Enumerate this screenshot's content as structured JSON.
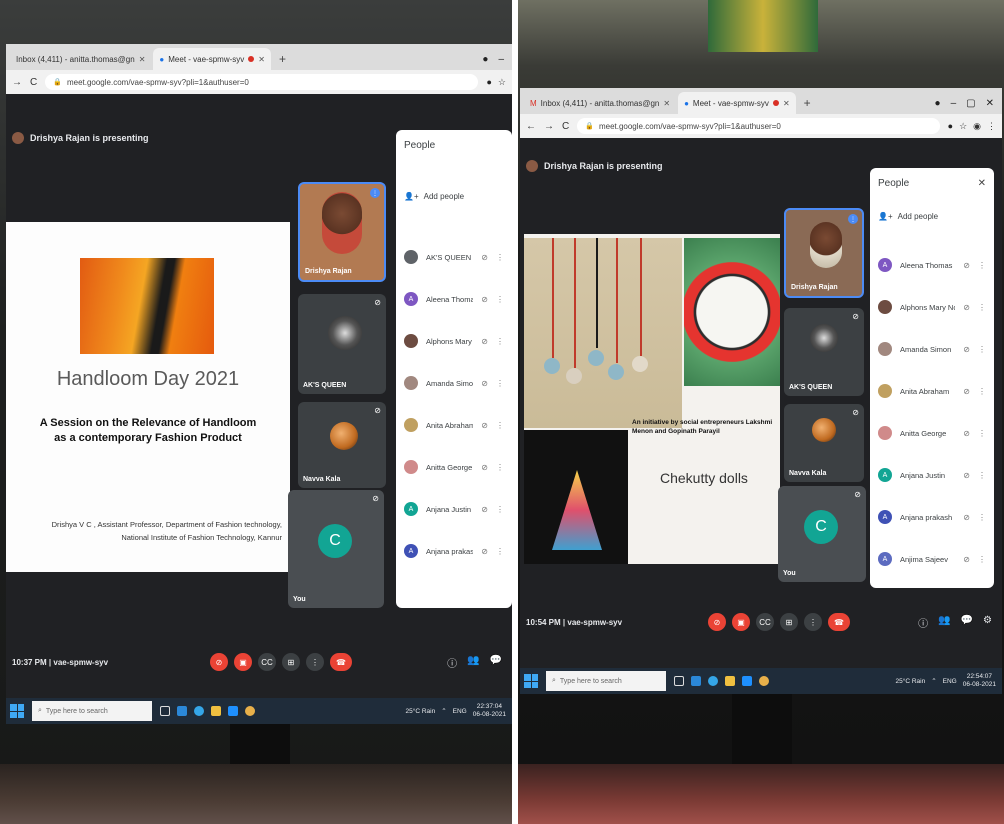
{
  "left": {
    "tabs": [
      {
        "label": "Inbox (4,411) - anitta.thomas@gn",
        "active": false
      },
      {
        "label": "Meet - vae-spmw-syv",
        "active": true
      }
    ],
    "address": "meet.google.com/vae-spmw-syv?pli=1&authuser=0",
    "presenting": "Drishya Rajan is presenting",
    "slide": {
      "title": "Handloom Day 2021",
      "subtitle": "A Session on the Relevance of Handloom as a contemporary Fashion Product",
      "credit_line1": "Drishya V C , Assistant Professor, Department of Fashion technology,",
      "credit_line2": "National Institute of Fashion Technology, Kannur"
    },
    "tiles": [
      {
        "name": "Drishya Rajan"
      },
      {
        "name": "AK'S QUEEN"
      },
      {
        "name": "Navva Kala"
      },
      {
        "name": "You",
        "initial": "C"
      }
    ],
    "people": {
      "title": "People",
      "add_label": "Add people",
      "list": [
        {
          "name": "AK'S QUEEN",
          "initial": "",
          "color": "#5f6368"
        },
        {
          "name": "Aleena Thomas",
          "initial": "A",
          "color": "#7e57c2"
        },
        {
          "name": "Alphons Mary Noby",
          "initial": "",
          "color": "#6d4c41"
        },
        {
          "name": "Amanda Simon",
          "initial": "",
          "color": "#a1887f"
        },
        {
          "name": "Anita Abraham",
          "initial": "",
          "color": "#c0a060"
        },
        {
          "name": "Anitta George",
          "initial": "",
          "color": "#d08a8a"
        },
        {
          "name": "Anjana Justin",
          "initial": "A",
          "color": "#12a594"
        },
        {
          "name": "Anjana prakash",
          "initial": "A",
          "color": "#3f51b5"
        }
      ]
    },
    "bottom": {
      "time_code": "10:37 PM | vae-spmw-syv"
    },
    "taskbar": {
      "search": "Type here to search",
      "weather": "25°C Rain",
      "lang": "ENG",
      "time": "22:37:04",
      "date": "06-08-2021"
    }
  },
  "right": {
    "tabs": [
      {
        "label": "Inbox (4,411) - anitta.thomas@gn",
        "active": false
      },
      {
        "label": "Meet - vae-spmw-syv",
        "active": true
      }
    ],
    "address": "meet.google.com/vae-spmw-syv?pli=1&authuser=0",
    "presenting": "Drishya Rajan is presenting",
    "slide": {
      "caption": "An initiative by social entrepreneurs Lakshmi Menon and Gopinath Parayil",
      "title": "Chekutty dolls"
    },
    "tiles": [
      {
        "name": "Drishya Rajan"
      },
      {
        "name": "AK'S QUEEN"
      },
      {
        "name": "Navva Kala"
      },
      {
        "name": "You",
        "initial": "C"
      }
    ],
    "people": {
      "title": "People",
      "add_label": "Add people",
      "list": [
        {
          "name": "Aleena Thomas",
          "initial": "A",
          "color": "#7e57c2"
        },
        {
          "name": "Alphons Mary Noby",
          "initial": "",
          "color": "#6d4c41"
        },
        {
          "name": "Amanda Simon",
          "initial": "",
          "color": "#a1887f"
        },
        {
          "name": "Anita Abraham",
          "initial": "",
          "color": "#c0a060"
        },
        {
          "name": "Anitta George",
          "initial": "",
          "color": "#d08a8a"
        },
        {
          "name": "Anjana Justin",
          "initial": "A",
          "color": "#12a594"
        },
        {
          "name": "Anjana prakash",
          "initial": "A",
          "color": "#3f51b5"
        },
        {
          "name": "Anjima Sajeev",
          "initial": "A",
          "color": "#5c6bc0"
        }
      ]
    },
    "bottom": {
      "time_code": "10:54 PM | vae-spmw-syv"
    },
    "taskbar": {
      "search": "Type here to search",
      "weather": "25°C Rain",
      "lang": "ENG",
      "time": "22:54:07",
      "date": "06-08-2021"
    }
  }
}
